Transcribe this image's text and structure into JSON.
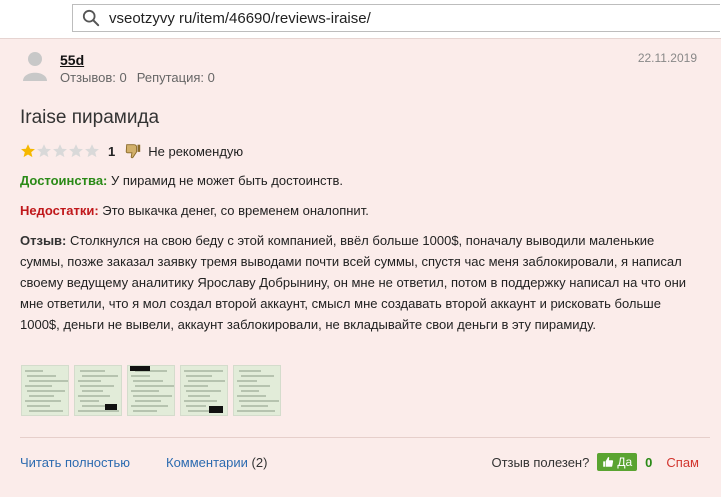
{
  "address_bar": {
    "url": "vseotzyvy ru/item/46690/reviews-iraise/"
  },
  "review": {
    "author": "55d",
    "reviews_label": "Отзывов: 0",
    "reputation_label": "Репутация: 0",
    "date": "22.11.2019",
    "title": "Iraise пирамида",
    "rating": {
      "value": 1,
      "max": 5,
      "label": "1",
      "verdict": "Не рекомендую"
    },
    "pros_label": "Достоинства:",
    "pros_text": " У пирамид не может быть достоинств.",
    "cons_label": "Недостатки:",
    "cons_text": " Это выкачка денег, со временем оналопнит.",
    "body_label": "Отзыв:",
    "body_text": " Столкнулся на свою беду с этой компанией, ввёл больше 1000$, поначалу выводили маленькие суммы, позже заказал заявку тремя выводами почти всей суммы, спустя час меня заблокировали, я написал своему ведущему аналитику Ярославу Добрынину, он мне не ответил, потом в поддержку написал на что они мне ответили, что я мол создал второй аккаунт, смысл мне создавать второй аккаунт и рисковать больше 1000$, деньги не вывели, аккаунт заблокировали, не вкладывайте свои деньги в эту пирамиду.",
    "screenshots_count": 5
  },
  "footer": {
    "read_more": "Читать полностью",
    "comments_label": "Комментарии",
    "comments_count": "(2)",
    "useful_question": "Отзыв полезен?",
    "yes_label": "Да",
    "yes_count": "0",
    "spam_label": "Спам"
  },
  "colors": {
    "card_bg": "#fbecea",
    "star_filled": "#f5b800",
    "star_empty": "#d9d9d9",
    "pros": "#2a8a17",
    "cons": "#c0181b",
    "link": "#2c6bb0",
    "yes_button": "#5aa431",
    "spam": "#d2352e"
  }
}
